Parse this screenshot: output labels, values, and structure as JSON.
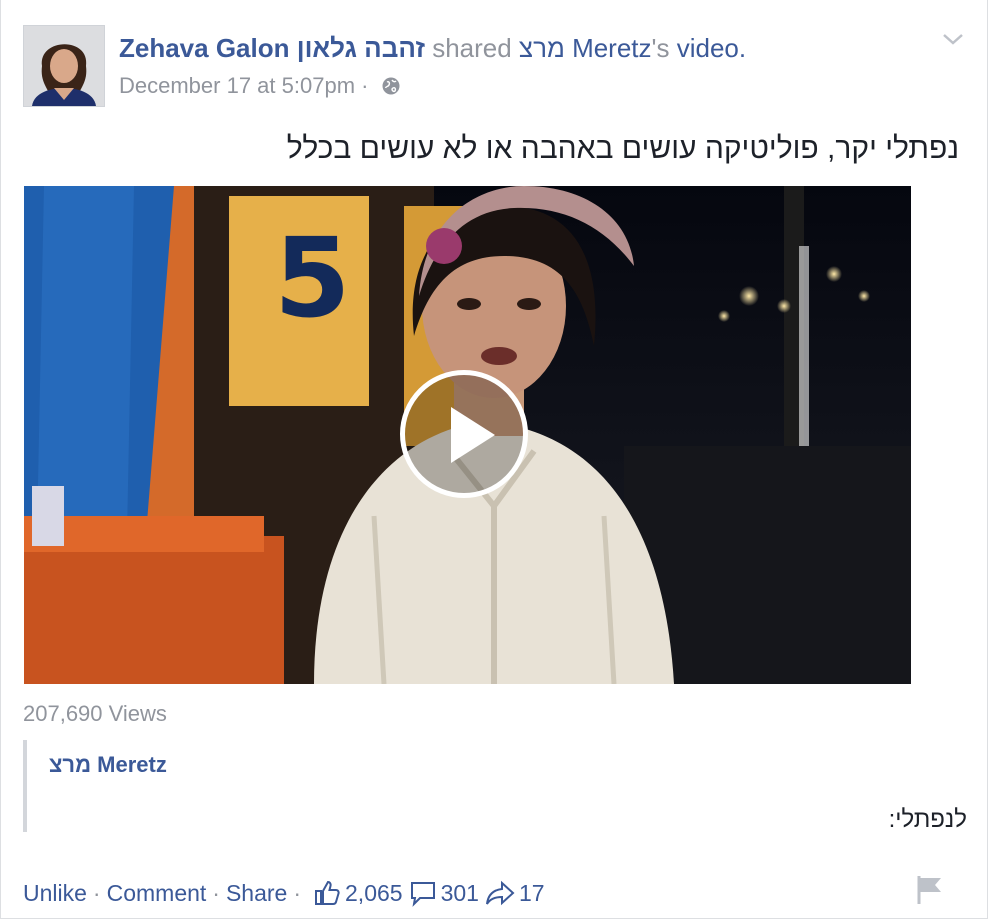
{
  "post": {
    "author": "Zehava Galon זהבה גלאון",
    "shared_word": "shared",
    "shared_source": "מרצ Meretz",
    "shared_suffix": "'s",
    "shared_object": "video.",
    "timestamp": "December 17 at 5:07pm",
    "separator": "·",
    "audience_icon": "globe-icon",
    "menu_icon": "chevron-down-icon",
    "message": "נפתלי יקר, פוליטיקה עושים באהבה או לא עושים בכלל"
  },
  "video": {
    "play_icon": "play-icon",
    "views": "207,690 Views"
  },
  "shared_post": {
    "author": "מרצ Meretz",
    "text": "לנפתלי:"
  },
  "actions": {
    "unlike": "Unlike",
    "comment": "Comment",
    "share": "Share",
    "dot": "·",
    "likes_count": "2,065",
    "comments_count": "301",
    "shares_count": "17",
    "like_icon": "thumbs-up-icon",
    "comment_icon": "speech-bubble-icon",
    "share_icon": "share-arrow-icon",
    "flag_icon": "flag-icon"
  },
  "colors": {
    "link_blue": "#3b5998",
    "muted_gray": "#90949c",
    "text": "#1d2129",
    "quote_bar": "#d3d6db"
  }
}
